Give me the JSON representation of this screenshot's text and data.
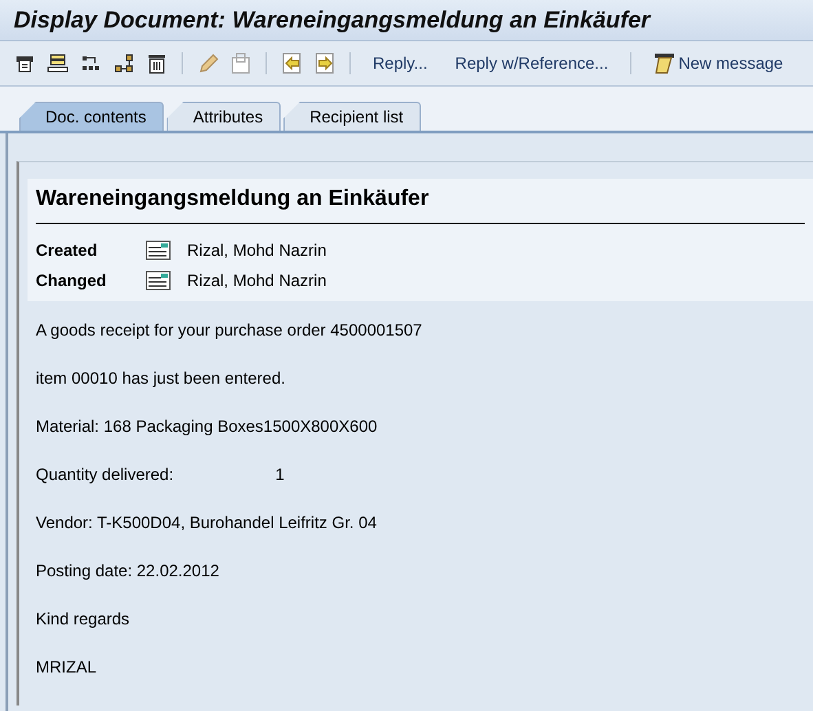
{
  "window": {
    "title": "Display Document: Wareneingangsmeldung an Einkäufer"
  },
  "toolbar": {
    "buttons": [
      {
        "label": "Reply...",
        "icon": false
      },
      {
        "label": "Reply w/Reference...",
        "icon": false
      },
      {
        "label": "New message",
        "icon": true
      }
    ]
  },
  "tabs": [
    {
      "label": "Doc. contents",
      "selected": true
    },
    {
      "label": "Attributes",
      "selected": false
    },
    {
      "label": "Recipient list",
      "selected": false
    }
  ],
  "document": {
    "title": "Wareneingangsmeldung an Einkäufer",
    "meta": [
      {
        "label": "Created",
        "name": "Rizal, Mohd Nazrin"
      },
      {
        "label": "Changed",
        "name": "Rizal, Mohd Nazrin"
      }
    ],
    "lines": [
      {
        "text": "A goods receipt for your purchase order 4500001507"
      },
      {
        "text": "item 00010 has just been entered."
      },
      {
        "text": "Material: 168 Packaging Boxes1500X800X600"
      },
      {
        "text": "Quantity delivered:",
        "value": "1"
      },
      {
        "text": "Vendor: T-K500D04, Burohandel Leifritz Gr. 04"
      },
      {
        "text": "Posting date: 22.02.2012"
      },
      {
        "text": "Kind regards"
      },
      {
        "text": "MRIZAL"
      }
    ]
  }
}
